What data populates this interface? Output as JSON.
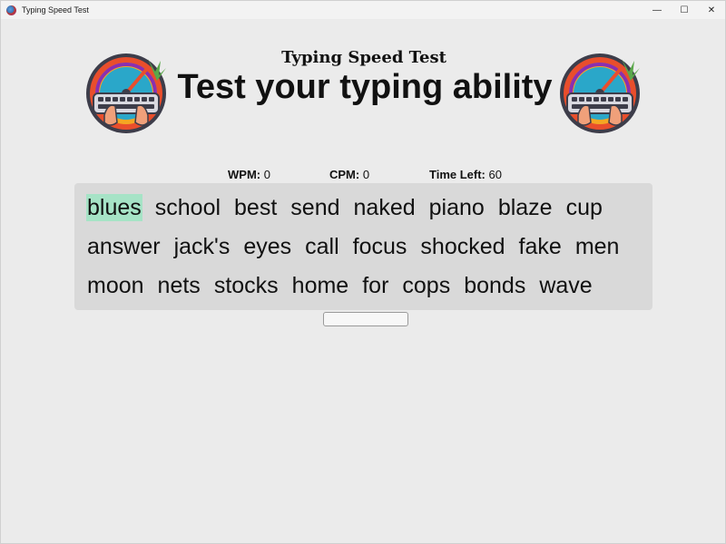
{
  "window": {
    "title": "Typing Speed Test",
    "controls": {
      "minimize": "—",
      "maximize": "☐",
      "close": "✕"
    }
  },
  "header": {
    "title": "Typing Speed Test",
    "subtitle": "Test your typing ability",
    "logo_icon": "speedometer-keyboard-logo"
  },
  "stats": {
    "wpm_label": "WPM:",
    "wpm_value": "0",
    "cpm_label": "CPM:",
    "cpm_value": "0",
    "time_label": "Time Left:",
    "time_value": "60"
  },
  "words": {
    "current_index": 0,
    "current_highlight_color": "#a6e3c6",
    "lines": [
      [
        "blues",
        "school",
        "best",
        "send",
        "naked",
        "piano",
        "blaze",
        "cup"
      ],
      [
        "answer",
        "jack's",
        "eyes",
        "call",
        "focus",
        "shocked",
        "fake",
        "men"
      ],
      [
        "moon",
        "nets",
        "stocks",
        "home",
        "for",
        "cops",
        "bonds",
        "wave"
      ]
    ]
  },
  "input": {
    "value": "",
    "placeholder": ""
  },
  "colors": {
    "background": "#ebebeb",
    "words_box": "#d9d9d9",
    "text": "#111111"
  }
}
